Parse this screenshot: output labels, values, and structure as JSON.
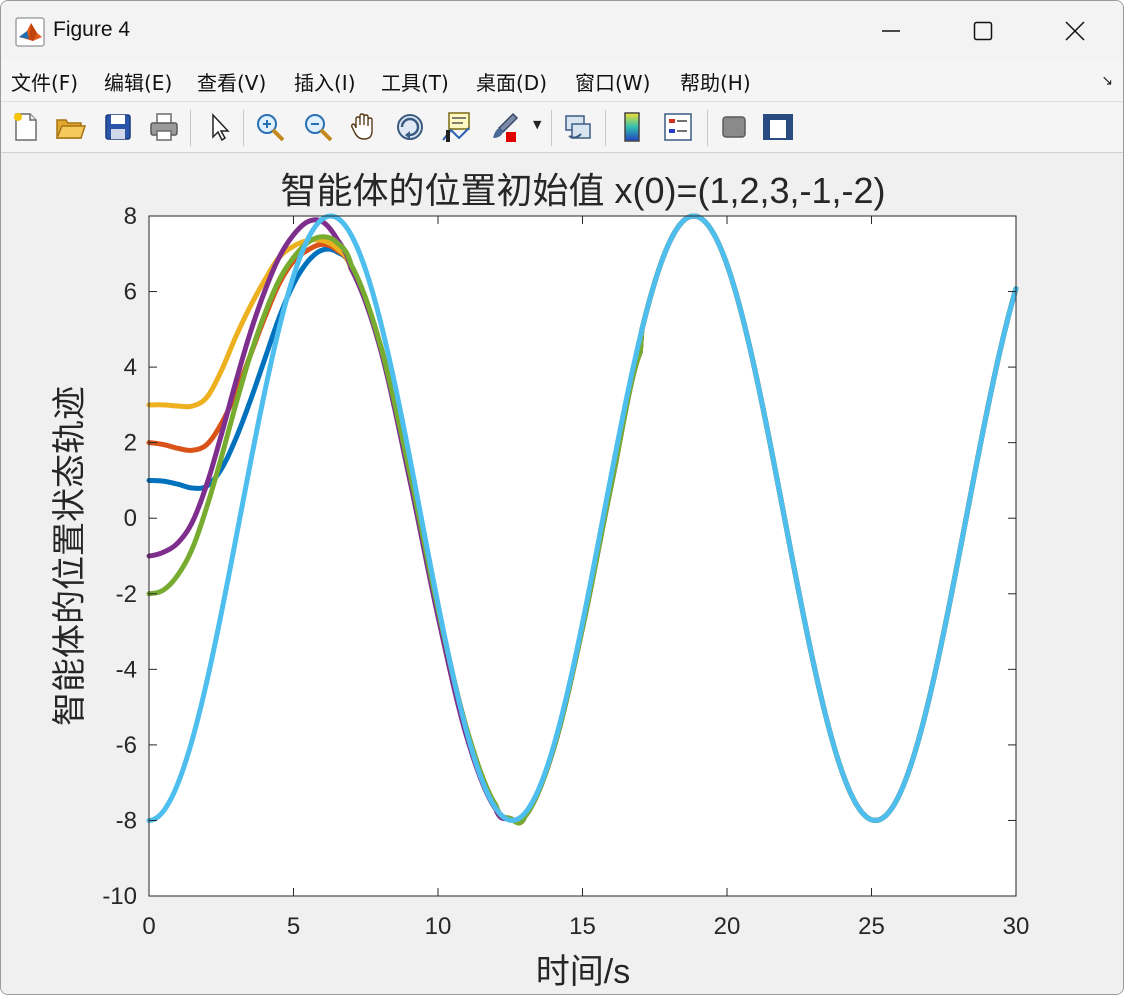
{
  "window": {
    "title": "Figure 4",
    "minimize_icon": "minimize-icon",
    "maximize_icon": "maximize-icon",
    "close_icon": "close-icon"
  },
  "menu": {
    "items": [
      "文件(F)",
      "编辑(E)",
      "查看(V)",
      "插入(I)",
      "工具(T)",
      "桌面(D)",
      "窗口(W)",
      "帮助(H)"
    ]
  },
  "toolbar": {
    "icons": [
      "new-figure-icon",
      "open-file-icon",
      "save-icon",
      "print-icon",
      "select-arrow-icon",
      "zoom-in-icon",
      "zoom-out-icon",
      "pan-hand-icon",
      "rotate-3d-icon",
      "data-cursor-icon",
      "brush-icon",
      "link-plot-icon",
      "colorbar-icon",
      "legend-icon",
      "hide-plot-tools-icon",
      "show-plot-tools-icon"
    ]
  },
  "chart_data": {
    "type": "line",
    "title": "智能体的位置初始值 x(0)=(1,2,3,-1,-2)",
    "xlabel": "时间/s",
    "ylabel": "智能体的位置状态轨迹",
    "xlim": [
      0,
      30
    ],
    "ylim": [
      -10,
      8
    ],
    "xticks": [
      0,
      5,
      10,
      15,
      20,
      25,
      30
    ],
    "yticks": [
      -10,
      -8,
      -6,
      -4,
      -2,
      0,
      2,
      4,
      6,
      8
    ],
    "grid": false,
    "series": [
      {
        "color": "#0072BD",
        "initial": 1,
        "x": [
          0,
          0.5,
          1,
          1.5,
          2,
          2.5,
          3,
          3.5,
          4,
          4.5,
          5,
          5.5,
          6,
          6.5,
          7,
          8,
          9,
          10,
          11,
          12,
          12.5,
          13,
          14,
          15,
          16,
          17
        ],
        "y": [
          1.0,
          0.98,
          0.9,
          0.8,
          0.85,
          1.3,
          2.1,
          3.1,
          4.2,
          5.3,
          6.2,
          6.8,
          7.1,
          7.05,
          6.6,
          4.6,
          1.3,
          -2.4,
          -5.6,
          -7.6,
          -7.95,
          -7.9,
          -6.1,
          -2.9,
          0.9,
          4.4
        ]
      },
      {
        "color": "#D95319",
        "initial": 2,
        "x": [
          0,
          0.5,
          1,
          1.5,
          2,
          2.5,
          3,
          3.5,
          4,
          4.5,
          5,
          5.5,
          6,
          6.5,
          7,
          8,
          9,
          10,
          11,
          12,
          12.5,
          13,
          14,
          15,
          16,
          17
        ],
        "y": [
          2.0,
          1.95,
          1.85,
          1.8,
          1.95,
          2.5,
          3.3,
          4.3,
          5.3,
          6.2,
          6.8,
          7.1,
          7.25,
          7.1,
          6.6,
          4.6,
          1.3,
          -2.4,
          -5.6,
          -7.6,
          -7.95,
          -7.9,
          -6.1,
          -2.9,
          0.9,
          4.4
        ]
      },
      {
        "color": "#EDB120",
        "initial": 3,
        "x": [
          0,
          0.5,
          1,
          1.5,
          2,
          2.5,
          3,
          3.5,
          4,
          4.5,
          5,
          5.5,
          6,
          6.5,
          7,
          8,
          9,
          10,
          11,
          12,
          12.5,
          13,
          14,
          15,
          16,
          17
        ],
        "y": [
          3.0,
          3.0,
          2.97,
          2.97,
          3.2,
          3.9,
          4.8,
          5.6,
          6.3,
          6.9,
          7.2,
          7.35,
          7.35,
          7.15,
          6.6,
          4.6,
          1.3,
          -2.4,
          -5.6,
          -7.6,
          -7.95,
          -7.9,
          -6.1,
          -2.9,
          0.9,
          4.4
        ]
      },
      {
        "color": "#7E2F8E",
        "initial": -1,
        "x": [
          0,
          0.5,
          1,
          1.5,
          2,
          2.5,
          3,
          3.5,
          4,
          4.5,
          5,
          5.5,
          6,
          6.5,
          7,
          8,
          9,
          10,
          11,
          12,
          12.5,
          13,
          14,
          15,
          16,
          17
        ],
        "y": [
          -1.0,
          -0.9,
          -0.65,
          -0.1,
          0.9,
          2.2,
          3.6,
          4.9,
          6.0,
          6.9,
          7.5,
          7.85,
          7.85,
          7.4,
          6.6,
          4.5,
          1.1,
          -2.6,
          -5.8,
          -7.7,
          -7.95,
          -7.9,
          -6.1,
          -2.9,
          0.9,
          4.4
        ]
      },
      {
        "color": "#77AC30",
        "initial": -2,
        "x": [
          0,
          0.5,
          1,
          1.5,
          2,
          2.5,
          3,
          3.5,
          4,
          4.5,
          5,
          5.5,
          6,
          6.5,
          7,
          8,
          9,
          10,
          11,
          12,
          12.5,
          13,
          14,
          15,
          16,
          17
        ],
        "y": [
          -2.0,
          -1.9,
          -1.5,
          -0.8,
          0.3,
          1.6,
          3.0,
          4.3,
          5.4,
          6.3,
          6.9,
          7.3,
          7.45,
          7.3,
          6.7,
          4.6,
          1.3,
          -2.4,
          -5.6,
          -7.6,
          -7.95,
          -7.9,
          -6.1,
          -2.9,
          0.9,
          4.4
        ]
      },
      {
        "color": "#4DBEEE",
        "function": "y = -8cos(t/2)",
        "x_range": [
          0,
          30
        ]
      }
    ]
  }
}
